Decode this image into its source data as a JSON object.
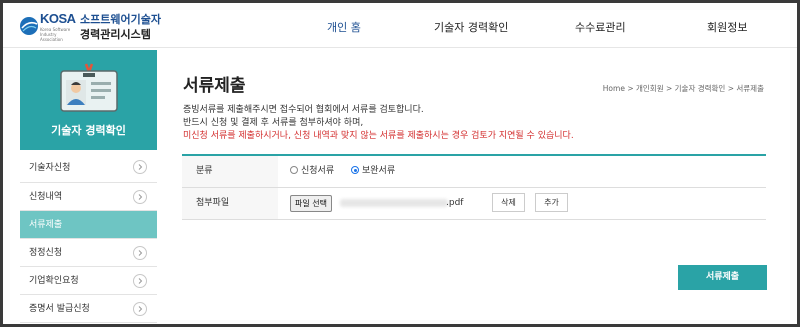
{
  "logo": {
    "kosa": "KOSA",
    "kosa_sub": "Korea Software Industry Association",
    "line1": "소프트웨어기술자",
    "line2": "경력관리시스템"
  },
  "gnb": [
    {
      "label": "개인 홈",
      "active": true
    },
    {
      "label": "기술자 경력확인",
      "active": false
    },
    {
      "label": "수수료관리",
      "active": false
    },
    {
      "label": "회원정보",
      "active": false
    }
  ],
  "sidebar": {
    "title": "기술자 경력확인",
    "items": [
      {
        "label": "기술자신청",
        "active": false
      },
      {
        "label": "신청내역",
        "active": false
      },
      {
        "label": "서류제출",
        "active": true
      },
      {
        "label": "정정신청",
        "active": false
      },
      {
        "label": "기업확인요청",
        "active": false
      },
      {
        "label": "증명서 발급신청",
        "active": false
      }
    ]
  },
  "main": {
    "title": "서류제출",
    "breadcrumb": "Home > 개인회원 > 기술자 경력확인 > 서류제출",
    "notice_line1": "증빙서류를 제출해주시면 접수되어 협회에서 서류를 검토합니다.",
    "notice_line2": "반드시 신청 및 결제 후 서류를 첨부하셔야 하며,",
    "notice_line3": "미신청 서류를 제출하시거나, 신청 내역과 맞지 않는 서류를 제출하시는 경우 검토가 지연될 수 있습니다.",
    "form": {
      "category_label": "분류",
      "radio_options": [
        {
          "label": "신청서류",
          "checked": false
        },
        {
          "label": "보완서류",
          "checked": true
        }
      ],
      "attach_label": "첨부파일",
      "file_button": "파일 선택",
      "file_ext": ".pdf",
      "delete_button": "삭제",
      "add_button": "추가"
    },
    "submit_button": "서류제출"
  },
  "colors": {
    "accent": "#2aa3a6",
    "accent_light": "#6ec5c3",
    "brand_blue": "#1d4f91",
    "warning_red": "#d32f2f"
  }
}
